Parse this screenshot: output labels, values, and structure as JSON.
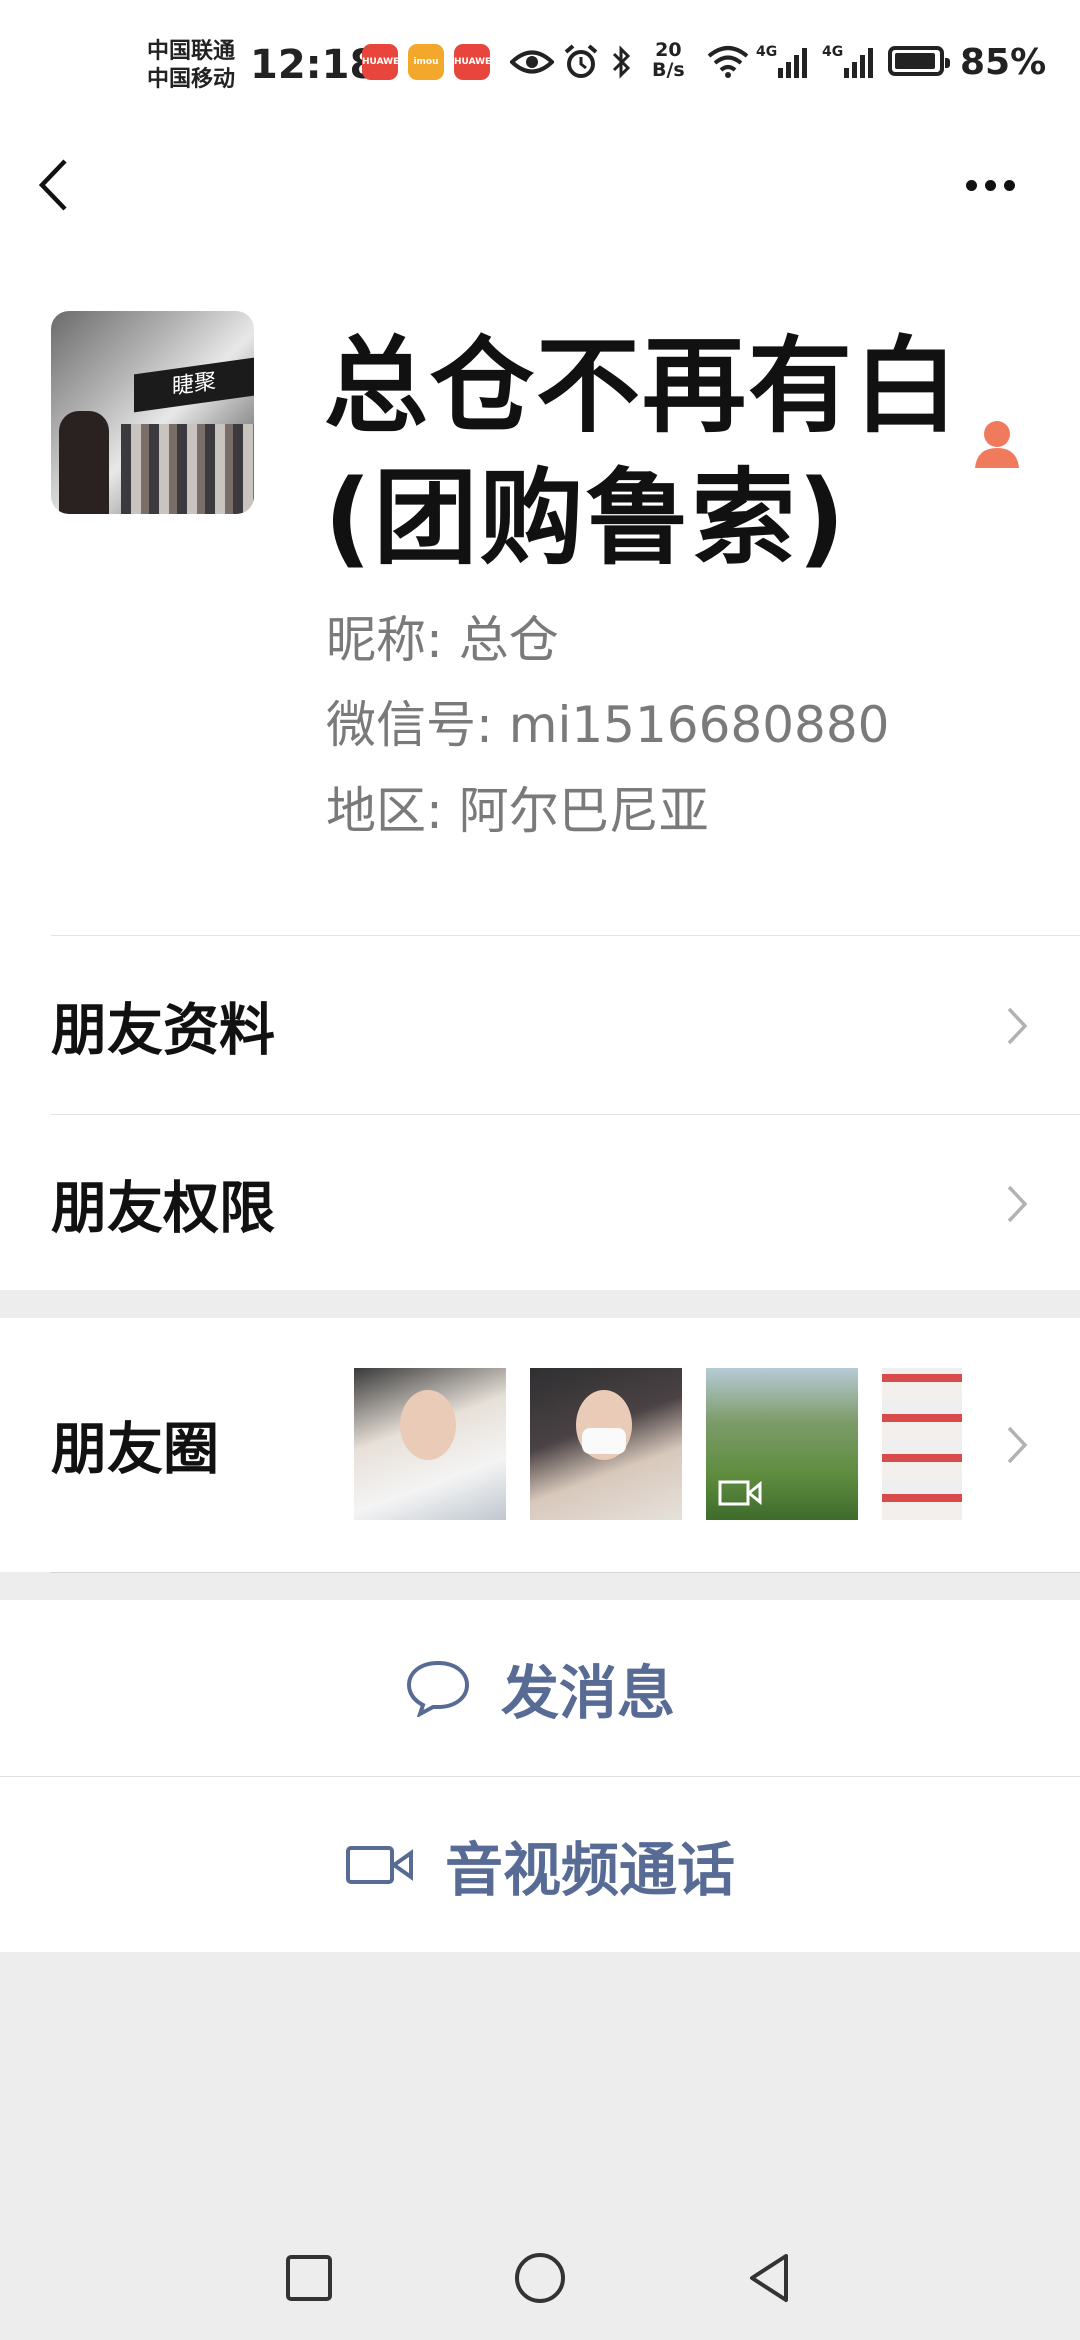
{
  "status_bar": {
    "carrier_1": "中国联通",
    "carrier_2": "中国移动",
    "time": "12:18",
    "net_speed_value": "20",
    "net_speed_unit": "B/s",
    "network_1": "4G",
    "network_2": "4G",
    "battery_percent": "85%",
    "app_icon_1": "HUAWEI",
    "app_icon_2": "imou",
    "app_icon_3": "HUAWEI"
  },
  "header": {
    "back_icon": "chevron-left-icon",
    "more_icon": "more-dots-icon"
  },
  "profile": {
    "title_line_1": "总仓不再有白",
    "title_line_2": "(团购鲁索)",
    "avatar_sign_text": "睫聚",
    "nickname_label": "昵称:",
    "nickname": "总仓",
    "wechat_id_label": "微信号:",
    "wechat_id": "mi1516680880",
    "region_label": "地区:",
    "region": "阿尔巴尼亚",
    "gender_icon": "person-icon",
    "gender_color": "#f07a5c"
  },
  "rows": {
    "friend_info": "朋友资料",
    "friend_permissions": "朋友权限",
    "moments": "朋友圈"
  },
  "actions": {
    "message": "发消息",
    "video_call": "音视频通话",
    "accent_color": "#576b95"
  },
  "navbar": {
    "recent_icon": "square-icon",
    "home_icon": "circle-icon",
    "back_icon": "triangle-back-icon"
  }
}
